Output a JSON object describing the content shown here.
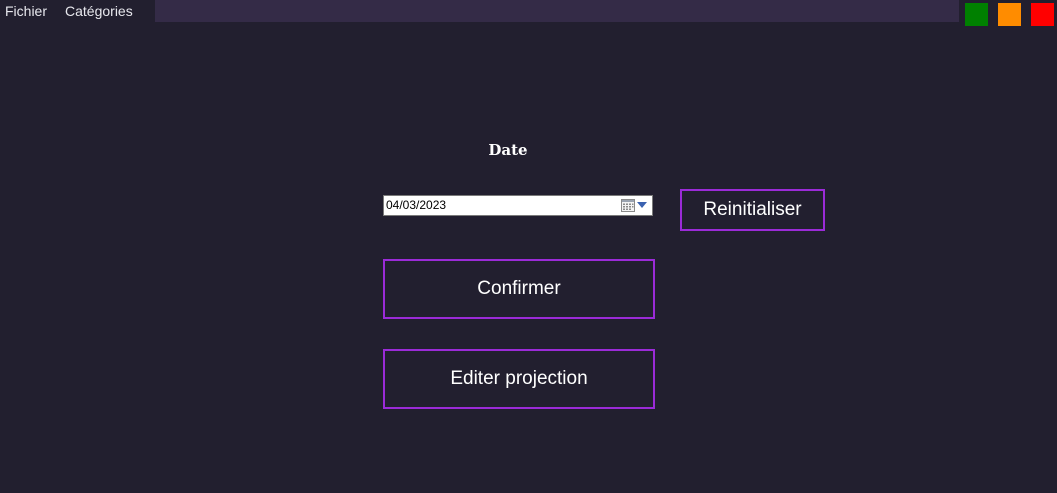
{
  "menu": {
    "items": [
      {
        "label": "Fichier"
      },
      {
        "label": "Catégories"
      }
    ]
  },
  "window_controls": {
    "colors": [
      "#008000",
      "#ff8c00",
      "#ff0000"
    ]
  },
  "form": {
    "date_label": "Date",
    "date_value": "04/03/2023",
    "reset_label": "Reinitialiser",
    "confirm_label": "Confirmer",
    "edit_label": "Editer projection"
  },
  "icons": {
    "calendar": "calendar-icon",
    "dropdown": "chevron-down-icon"
  },
  "colors": {
    "background": "#221f2f",
    "button_border": "#9b2bd8",
    "menubar_extension": "#342b47"
  }
}
